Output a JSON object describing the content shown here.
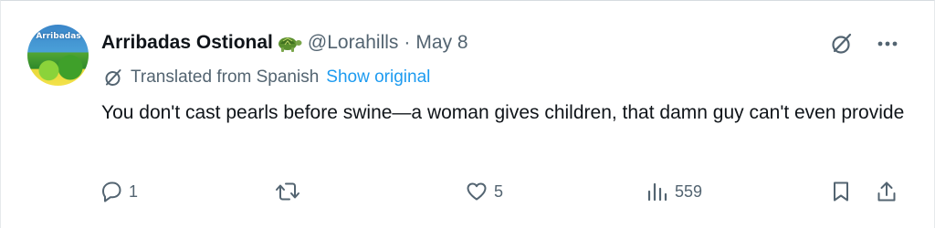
{
  "author": {
    "avatar_text": "Arribadas",
    "display_name": "Arribadas Ostional",
    "emoji_icon": "turtle-icon",
    "handle": "@Lorahills",
    "separator": "·",
    "date": "May 8"
  },
  "translation": {
    "label": "Translated from Spanish",
    "show_original": "Show original"
  },
  "tweet": {
    "text": "You don't cast pearls before swine—a woman gives children, that damn guy can't even provide"
  },
  "stats": {
    "replies": "1",
    "reposts": "",
    "likes": "5",
    "views": "559"
  },
  "colors": {
    "text": "#0f1419",
    "secondary": "#536471",
    "link": "#1d9bf0"
  }
}
